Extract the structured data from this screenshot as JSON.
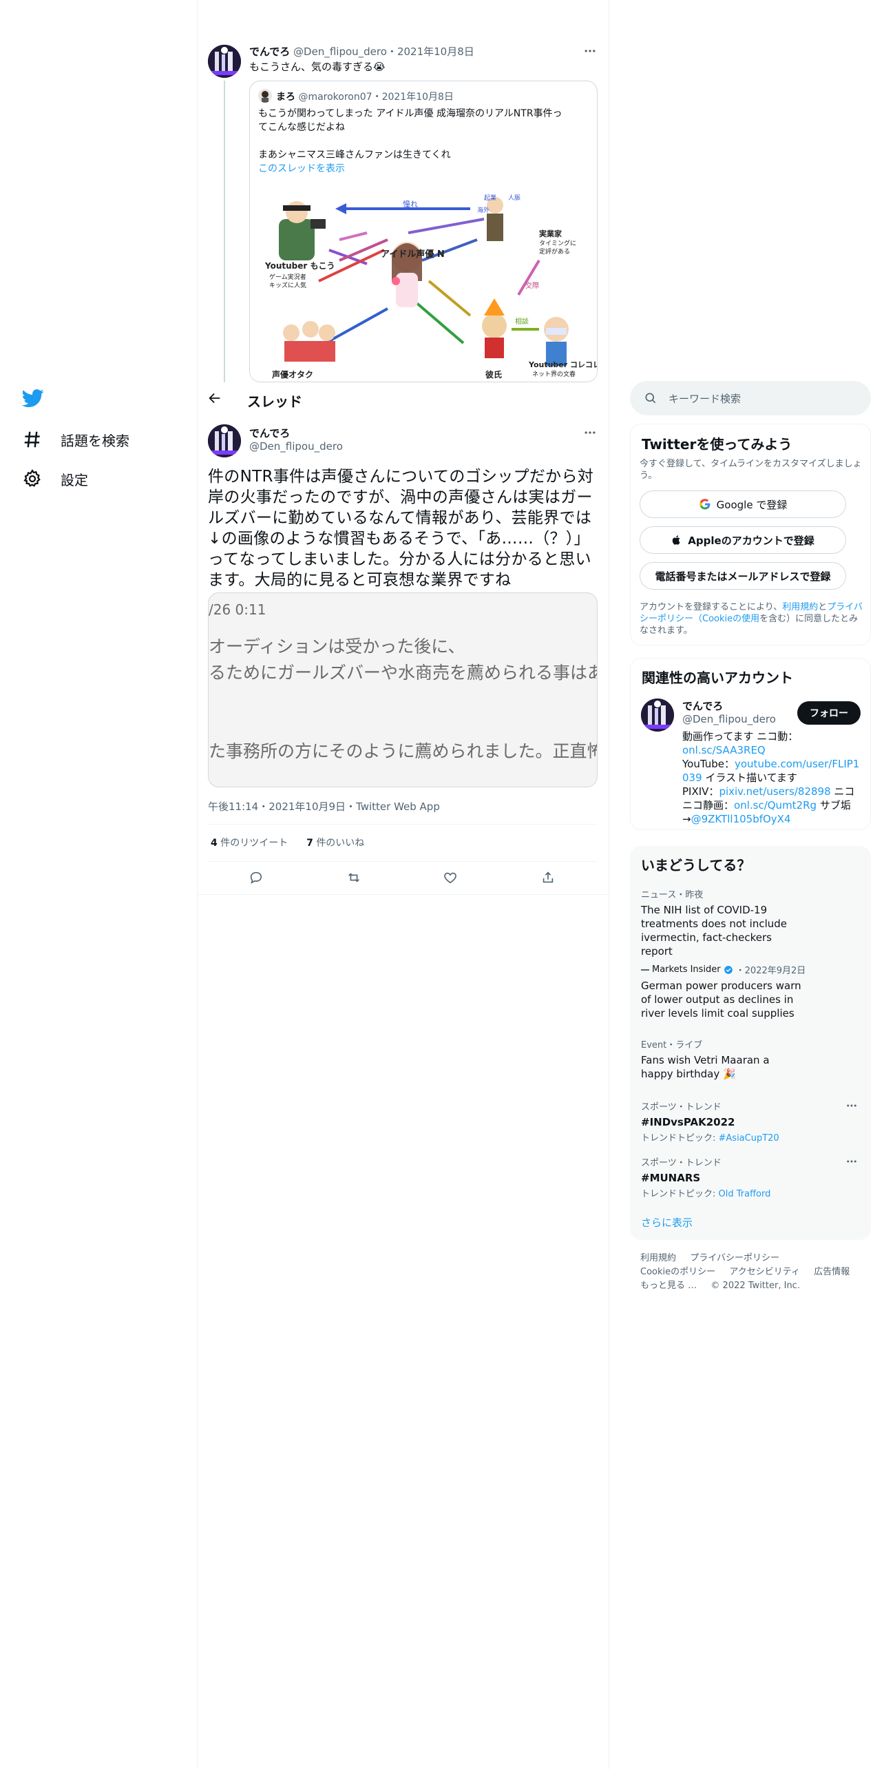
{
  "nav": {
    "items": [
      {
        "label": "話題を検索",
        "icon": "hashtag-icon"
      },
      {
        "label": "設定",
        "icon": "gear-icon"
      }
    ]
  },
  "parent_tweet": {
    "name": "でんでろ",
    "handle": "@Den_flipou_dero",
    "date": "2021年10月8日",
    "text": "もこうさん、気の毒すぎる😭",
    "quote": {
      "name": "まろ",
      "handle": "@marokoron07",
      "date": "2021年10月8日",
      "text_line1": "もこうが関わってしまった アイドル声優 成海瑠奈のリアルNTR事件っ",
      "text_line2": "てこんな感じだよね",
      "text_line3": "まあシャニマス三峰さんファンは生きてくれ",
      "show_thread": "このスレッドを表示",
      "figure": {
        "youtuber": "Youtuber もこう",
        "youtuber_sub1": "ゲーム実況者",
        "youtuber_sub2": "キッズに人気",
        "center": "アイドル声優 N",
        "otaku": "声優オタク",
        "kareshi": "彼氏",
        "collab": "Youtuber コレコレ",
        "collab_sub": "ネット界の文春",
        "ai": "憧れ",
        "biz": "起業",
        "kaigai": "海外",
        "jinmyaku": "人脈",
        "jigyouka": "実業家",
        "jigyouka_sub": "タイミングに",
        "jigyouka_sub2": "定評がある",
        "soudan": "相談",
        "kousai": "交際"
      }
    }
  },
  "header": {
    "title": "スレッド"
  },
  "main_tweet": {
    "name": "でんでろ",
    "handle": "@Den_flipou_dero",
    "text": "件のNTR事件は声優さんについてのゴシップだから対岸の火事だったのですが、渦中の声優さんは実はガールズバーに勤めているなんて情報があり、芸能界では↓の画像のような慣習もあるそうで、「あ……（？）」ってなってしまいました。分かる人には分かると思います。大局的に見ると可哀想な業界ですね",
    "media": {
      "line1": "/26 0:11",
      "line2": "オーディションは受かった後に、",
      "line3": "るためにガールズバーや水商売を薦められる事はあ",
      "line4": "た事務所の方にそのように薦められました。正直怖"
    },
    "timestamp": "午後11:14・2021年10月9日・Twitter Web App",
    "retweets_count": "4",
    "retweets_label": "件のリツイート",
    "likes_count": "7",
    "likes_label": "件のいいね"
  },
  "search": {
    "placeholder": "キーワード検索"
  },
  "signup": {
    "title": "Twitterを使ってみよう",
    "subtitle": "今すぐ登録して、タイムラインをカスタマイズしましょう。",
    "google": "Google で登録",
    "apple": "Appleのアカウントで登録",
    "phone": "電話番号またはメールアドレスで登録",
    "terms_pre": "アカウントを登録することにより、",
    "terms_link1": "利用規約",
    "terms_mid": "と",
    "terms_link2": "プライバシーポリシー（Cookieの使用",
    "terms_post": "を含む）に同意したとみなされます。"
  },
  "related": {
    "title": "関連性の高いアカウント",
    "name": "でんでろ",
    "handle": "@Den_flipou_dero",
    "follow": "フォロー",
    "bio_1": "動画作ってます ニコ動：",
    "bio_link1": "onl.sc/SAA3REQ",
    "bio_2": "YouTube：",
    "bio_link2": "youtube.com/user/FLIP1039",
    "bio_3": " イラスト描いてます",
    "bio_4": "PIXIV：",
    "bio_link3": "pixiv.net/users/82898",
    "bio_5": " ニコニコ静画：",
    "bio_link4": "onl.sc/Qumt2Rg",
    "bio_6": " サブ垢→",
    "bio_link5": "@9ZKTll105bfOyX4"
  },
  "trends": {
    "title": "いまどうしてる？",
    "items": [
      {
        "meta": "ニュース・昨夜",
        "text": "The NIH list of COVID-19 treatments does not include ivermectin, fact-checkers report"
      },
      {
        "meta_source": "Markets Insider",
        "meta_date": "・2022年9月2日",
        "text": "German power producers warn of lower output as declines in river levels limit coal supplies"
      },
      {
        "meta": "Event・ライブ",
        "text": "Fans wish Vetri Maaran a happy birthday 🎉"
      },
      {
        "meta": "スポーツ・トレンド",
        "title": "#INDvsPAK2022",
        "topic_label": "トレンドトピック: ",
        "topic": "#AsiaCupT20"
      },
      {
        "meta": "スポーツ・トレンド",
        "title": "#MUNARS",
        "topic_label": "トレンドトピック: ",
        "topic": "Old Trafford"
      }
    ],
    "show_more": "さらに表示"
  },
  "footer": {
    "terms": "利用規約",
    "privacy": "プライバシーポリシー",
    "cookie": "Cookieのポリシー",
    "access": "アクセシビリティ",
    "ads": "広告情報",
    "more": "もっと見る …",
    "copy": "© 2022 Twitter, Inc."
  },
  "colors": {
    "accent": "#1d9bf0",
    "text": "#0f1419",
    "muted": "#536471",
    "border": "#eff3f4"
  }
}
